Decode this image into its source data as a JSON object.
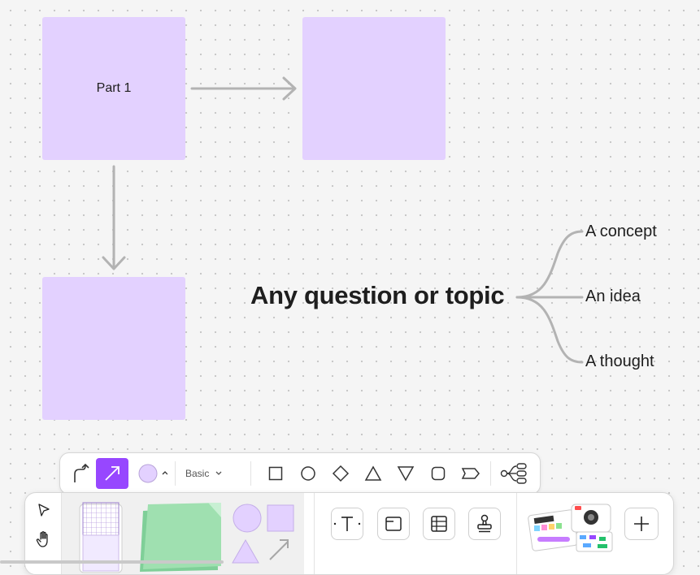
{
  "canvas": {
    "stickies": [
      {
        "label": "Part 1"
      },
      {
        "label": ""
      },
      {
        "label": ""
      }
    ]
  },
  "mindmap": {
    "center": "Any question or topic",
    "branches": [
      "A concept",
      "An idea",
      "A thought"
    ]
  },
  "subbar": {
    "connector_style": "Basic",
    "fill_color": "#e3d1ff",
    "accent_color": "#9747ff",
    "shapes": [
      "square-icon",
      "circle-icon",
      "diamond-icon",
      "triangle-icon",
      "triangle-down-icon",
      "rounded-square-icon",
      "chevron-tag-icon"
    ]
  },
  "toolbar": {
    "tools": [
      "pointer-icon",
      "hand-icon",
      "sticky-note-tool",
      "shapes-tool",
      "text-icon",
      "section-icon",
      "table-icon",
      "stamp-icon",
      "widgets-tool",
      "plus-icon"
    ]
  }
}
